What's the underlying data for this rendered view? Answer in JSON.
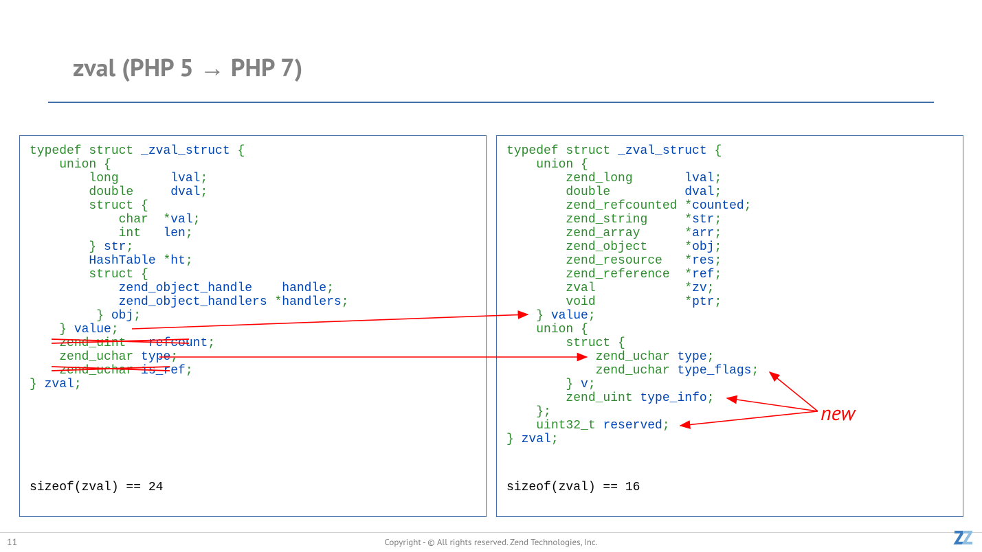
{
  "title": "zval (PHP 5 → PHP 7)",
  "page_number": "11",
  "copyright": "Copyright - © All rights reserved. Zend Technologies, Inc.",
  "annotation_new": "new",
  "colors": {
    "keyword": "#2e8b2e",
    "identifier": "#0147b5",
    "arrow": "#ff0000",
    "title": "#818181",
    "rule": "#4472a8"
  },
  "left": {
    "sizeof": "sizeof(zval) == 24",
    "struck_lines": [
      "zend_uint   refcount;",
      "zend_uchar is_ref;"
    ],
    "code": [
      {
        "indent": 0,
        "tokens": [
          [
            "kw",
            "typedef struct"
          ],
          [
            "id",
            " _zval_struct "
          ],
          [
            "kw",
            "{"
          ]
        ]
      },
      {
        "indent": 1,
        "tokens": [
          [
            "kw",
            "union {"
          ]
        ]
      },
      {
        "indent": 2,
        "tokens": [
          [
            "kw",
            "long       "
          ],
          [
            "id",
            "lval"
          ],
          [
            "kw",
            ";"
          ]
        ]
      },
      {
        "indent": 2,
        "tokens": [
          [
            "kw",
            "double     "
          ],
          [
            "id",
            "dval"
          ],
          [
            "kw",
            ";"
          ]
        ]
      },
      {
        "indent": 2,
        "tokens": [
          [
            "kw",
            "struct {"
          ]
        ]
      },
      {
        "indent": 3,
        "tokens": [
          [
            "kw",
            "char  *"
          ],
          [
            "id",
            "val"
          ],
          [
            "kw",
            ";"
          ]
        ]
      },
      {
        "indent": 3,
        "tokens": [
          [
            "kw",
            "int   "
          ],
          [
            "id",
            "len"
          ],
          [
            "kw",
            ";"
          ]
        ]
      },
      {
        "indent": 2,
        "tokens": [
          [
            "kw",
            "} "
          ],
          [
            "id",
            "str"
          ],
          [
            "kw",
            ";"
          ]
        ]
      },
      {
        "indent": 2,
        "tokens": [
          [
            "id",
            "HashTable "
          ],
          [
            "kw",
            "*"
          ],
          [
            "id",
            "ht"
          ],
          [
            "kw",
            ";"
          ]
        ]
      },
      {
        "indent": 2,
        "tokens": [
          [
            "kw",
            "struct {"
          ]
        ]
      },
      {
        "indent": 3,
        "tokens": [
          [
            "id",
            "zend_object_handle    "
          ],
          [
            "id",
            "handle"
          ],
          [
            "kw",
            ";"
          ]
        ]
      },
      {
        "indent": 3,
        "tokens": [
          [
            "id",
            "zend_object_handlers "
          ],
          [
            "kw",
            "*"
          ],
          [
            "id",
            "handlers"
          ],
          [
            "kw",
            ";"
          ]
        ]
      },
      {
        "indent": 2,
        "tokens": [
          [
            "kw",
            " } "
          ],
          [
            "id",
            "obj"
          ],
          [
            "kw",
            ";"
          ]
        ]
      },
      {
        "indent": 1,
        "tokens": [
          [
            "kw",
            "} "
          ],
          [
            "id",
            "value"
          ],
          [
            "kw",
            ";"
          ]
        ]
      },
      {
        "indent": 1,
        "tokens": [
          [
            "kw",
            "zend_uint   "
          ],
          [
            "id",
            "refcount"
          ],
          [
            "kw",
            ";"
          ]
        ]
      },
      {
        "indent": 1,
        "tokens": [
          [
            "kw",
            "zend_uchar "
          ],
          [
            "id",
            "type"
          ],
          [
            "kw",
            ";"
          ]
        ]
      },
      {
        "indent": 1,
        "tokens": [
          [
            "kw",
            "zend_uchar "
          ],
          [
            "id",
            "is_ref"
          ],
          [
            "kw",
            ";"
          ]
        ]
      },
      {
        "indent": 0,
        "tokens": [
          [
            "kw",
            "} "
          ],
          [
            "id",
            "zval"
          ],
          [
            "kw",
            ";"
          ]
        ]
      }
    ]
  },
  "right": {
    "sizeof": "sizeof(zval) == 16",
    "code": [
      {
        "indent": 0,
        "tokens": [
          [
            "kw",
            "typedef struct"
          ],
          [
            "id",
            " _zval_struct "
          ],
          [
            "kw",
            "{"
          ]
        ]
      },
      {
        "indent": 1,
        "tokens": [
          [
            "kw",
            "union {"
          ]
        ]
      },
      {
        "indent": 2,
        "tokens": [
          [
            "kw",
            "zend_long       "
          ],
          [
            "id",
            "lval"
          ],
          [
            "kw",
            ";"
          ]
        ]
      },
      {
        "indent": 2,
        "tokens": [
          [
            "kw",
            "double          "
          ],
          [
            "id",
            "dval"
          ],
          [
            "kw",
            ";"
          ]
        ]
      },
      {
        "indent": 2,
        "tokens": [
          [
            "kw",
            "zend_refcounted "
          ],
          [
            "kw",
            "*"
          ],
          [
            "id",
            "counted"
          ],
          [
            "kw",
            ";"
          ]
        ]
      },
      {
        "indent": 2,
        "tokens": [
          [
            "kw",
            "zend_string     "
          ],
          [
            "kw",
            "*"
          ],
          [
            "id",
            "str"
          ],
          [
            "kw",
            ";"
          ]
        ]
      },
      {
        "indent": 2,
        "tokens": [
          [
            "kw",
            "zend_array      "
          ],
          [
            "kw",
            "*"
          ],
          [
            "id",
            "arr"
          ],
          [
            "kw",
            ";"
          ]
        ]
      },
      {
        "indent": 2,
        "tokens": [
          [
            "kw",
            "zend_object     "
          ],
          [
            "kw",
            "*"
          ],
          [
            "id",
            "obj"
          ],
          [
            "kw",
            ";"
          ]
        ]
      },
      {
        "indent": 2,
        "tokens": [
          [
            "kw",
            "zend_resource   "
          ],
          [
            "kw",
            "*"
          ],
          [
            "id",
            "res"
          ],
          [
            "kw",
            ";"
          ]
        ]
      },
      {
        "indent": 2,
        "tokens": [
          [
            "kw",
            "zend_reference  "
          ],
          [
            "kw",
            "*"
          ],
          [
            "id",
            "ref"
          ],
          [
            "kw",
            ";"
          ]
        ]
      },
      {
        "indent": 2,
        "tokens": [
          [
            "kw",
            "zval            "
          ],
          [
            "kw",
            "*"
          ],
          [
            "id",
            "zv"
          ],
          [
            "kw",
            ";"
          ]
        ]
      },
      {
        "indent": 2,
        "tokens": [
          [
            "kw",
            "void            "
          ],
          [
            "kw",
            "*"
          ],
          [
            "id",
            "ptr"
          ],
          [
            "kw",
            ";"
          ]
        ]
      },
      {
        "indent": 1,
        "tokens": [
          [
            "kw",
            "} "
          ],
          [
            "id",
            "value"
          ],
          [
            "kw",
            ";"
          ]
        ]
      },
      {
        "indent": 1,
        "tokens": [
          [
            "kw",
            "union {"
          ]
        ]
      },
      {
        "indent": 2,
        "tokens": [
          [
            "kw",
            "struct {"
          ]
        ]
      },
      {
        "indent": 3,
        "tokens": [
          [
            "kw",
            "zend_uchar "
          ],
          [
            "id",
            "type"
          ],
          [
            "kw",
            ";"
          ]
        ]
      },
      {
        "indent": 3,
        "tokens": [
          [
            "kw",
            "zend_uchar "
          ],
          [
            "id",
            "type_flags"
          ],
          [
            "kw",
            ";"
          ]
        ]
      },
      {
        "indent": 2,
        "tokens": [
          [
            "kw",
            "} "
          ],
          [
            "id",
            "v"
          ],
          [
            "kw",
            ";"
          ]
        ]
      },
      {
        "indent": 2,
        "tokens": [
          [
            "kw",
            "zend_uint "
          ],
          [
            "id",
            "type_info"
          ],
          [
            "kw",
            ";"
          ]
        ]
      },
      {
        "indent": 1,
        "tokens": [
          [
            "kw",
            "};"
          ]
        ]
      },
      {
        "indent": 1,
        "tokens": [
          [
            "kw",
            "uint32_t "
          ],
          [
            "id",
            "reserved"
          ],
          [
            "kw",
            ";"
          ]
        ]
      },
      {
        "indent": 0,
        "tokens": [
          [
            "kw",
            "} "
          ],
          [
            "id",
            "zval"
          ],
          [
            "kw",
            ";"
          ]
        ]
      }
    ]
  }
}
